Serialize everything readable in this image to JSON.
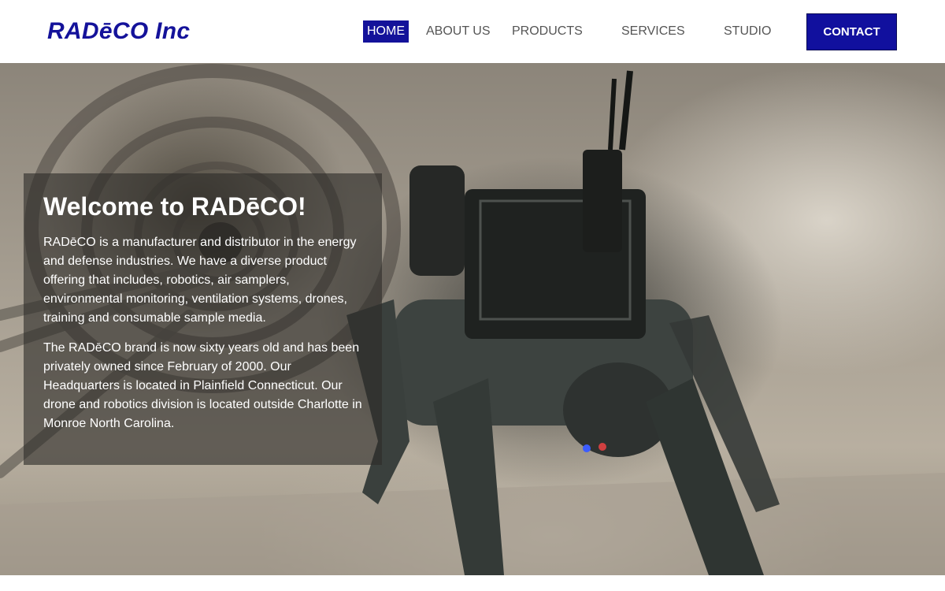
{
  "header": {
    "logo_text": "RADēCO Inc",
    "nav": [
      {
        "label": "HOME",
        "active": true
      },
      {
        "label": "ABOUT US",
        "active": false
      },
      {
        "label": "PRODUCTS",
        "active": false
      },
      {
        "label": "SERVICES",
        "active": false
      },
      {
        "label": "STUDIO",
        "active": false
      }
    ],
    "contact_label": "CONTACT"
  },
  "hero": {
    "image_subject": "quadruped-robot-in-tunnel",
    "title": "Welcome to RADēCO!",
    "paragraphs": [
      "RADēCO is a manufacturer and distributor in the energy and defense industries. We have a diverse product offering that includes, robotics, air samplers, environmental monitoring, ventilation systems, drones, training and consumable sample media.",
      "The RADēCO brand is now sixty years old and has been privately owned since February of 2000. Our Headquarters is located in Plainfield Connecticut. Our drone and robotics division is located outside Charlotte in Monroe North Carolina."
    ]
  },
  "colors": {
    "brand": "#14129a",
    "contact_button": "#11109e",
    "nav_text": "#555555",
    "panel_overlay": "rgba(45,43,40,0.62)"
  }
}
